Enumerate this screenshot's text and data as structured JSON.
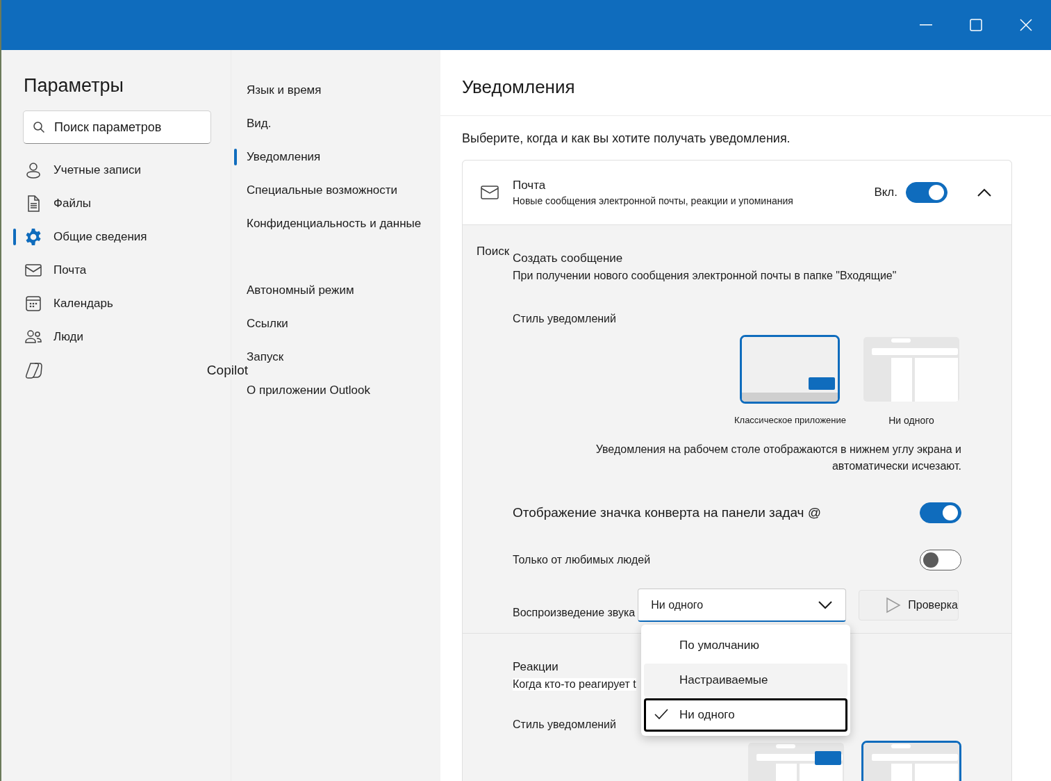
{
  "sidebar": {
    "title": "Параметры",
    "search": {
      "placeholder": "Поиск параметров"
    },
    "items": [
      {
        "label": "Учетные записи",
        "kind": "person",
        "selected": false
      },
      {
        "label": "Файлы",
        "kind": "file",
        "selected": false
      },
      {
        "label": "Общие сведения",
        "kind": "gear",
        "selected": true
      },
      {
        "label": "Почта",
        "kind": "mail",
        "selected": false
      },
      {
        "label": "Календарь",
        "kind": "calendar",
        "selected": false
      },
      {
        "label": "Люди",
        "kind": "people",
        "selected": false
      },
      {
        "label": "Copilot",
        "kind": "copilot",
        "selected": false
      }
    ]
  },
  "subnav": {
    "items": [
      {
        "label": "Язык и время",
        "selected": false
      },
      {
        "label": "Вид.",
        "selected": false
      },
      {
        "label": "Уведомления",
        "selected": true
      },
      {
        "label": "Специальные возможности",
        "selected": false
      },
      {
        "label": "Конфиденциальность и данные",
        "selected": false
      },
      {
        "label": "Автономный режим",
        "selected": false
      },
      {
        "label": "Ссылки",
        "selected": false
      },
      {
        "label": "Запуск",
        "selected": false
      },
      {
        "label": "О приложении Outlook",
        "selected": false
      }
    ]
  },
  "content": {
    "title": "Уведомления",
    "intro": "Выберите, когда и как вы хотите получать уведомления.",
    "card": {
      "title": "Почта",
      "subtitle": "Новые сообщения электронной почты, реакции и упоминания",
      "toggle_label": "Вкл.",
      "on": true,
      "expanded": true,
      "overlay_text": "Поиск",
      "section": {
        "title": "Создать сообщение",
        "description": "При получении нового сообщения электронной почты в папке \"Входящие\"",
        "style_label": "Стиль уведомлений",
        "styles": [
          {
            "label": "Классическое приложение",
            "kind": "desktop",
            "selected": true
          },
          {
            "label": "Ни одного",
            "kind": "none",
            "selected": false
          }
        ],
        "style_note": "Уведомления на рабочем столе отображаются в нижнем углу экрана и автоматически исчезают.",
        "toggles": [
          {
            "label": "Отображение значка конверта на панели задач @",
            "kind": "large",
            "on": true
          },
          {
            "label": "Только от любимых людей",
            "kind": "normal",
            "on": false
          }
        ],
        "sound": {
          "label": "Воспроизведение звука",
          "value": "Ни одного",
          "expanded": true,
          "test_button": "Проверка",
          "options": [
            {
              "label": "По умолчанию",
              "selected": false,
              "hovered": false
            },
            {
              "label": "Настраиваемые",
              "selected": false,
              "hovered": true
            },
            {
              "label": "Ни одного",
              "selected": true,
              "hovered": false
            }
          ]
        }
      },
      "section2": {
        "title": "Реакции",
        "description": "Когда кто-то реагирует t",
        "style_label": "Стиль уведомлений",
        "styles": [
          {
            "kind": "popup",
            "selected": false
          },
          {
            "kind": "none",
            "selected": true
          }
        ]
      }
    }
  }
}
